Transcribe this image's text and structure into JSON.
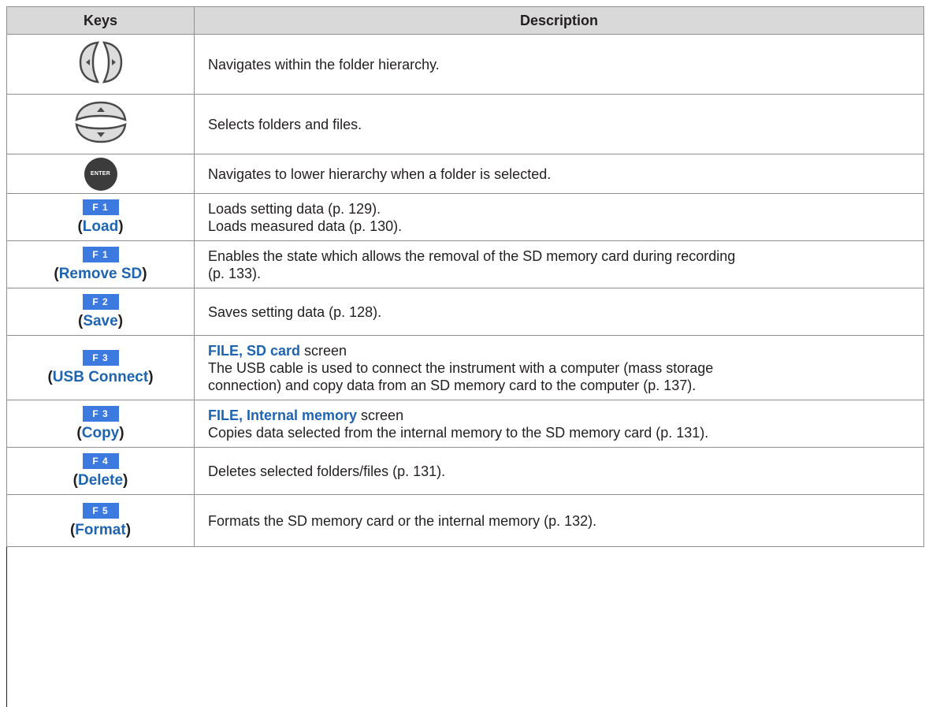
{
  "table": {
    "headers": {
      "keys": "Keys",
      "description": "Description"
    },
    "rows": [
      {
        "key_type": "left-right-arrows",
        "description": [
          "Navigates within the folder hierarchy."
        ]
      },
      {
        "key_type": "up-down-arrows",
        "description": [
          "Selects folders and files."
        ]
      },
      {
        "key_type": "enter",
        "key_label": "ENTER",
        "description": [
          "Navigates to lower hierarchy when a folder is selected."
        ]
      },
      {
        "key_type": "function",
        "fkey": "F1",
        "name_open": "(",
        "name": "Load",
        "name_close": ")",
        "description": [
          "Loads setting data (p. 129).",
          "Loads measured data (p. 130)."
        ]
      },
      {
        "key_type": "function",
        "fkey": "F1",
        "name_open": "(",
        "name": "Remove SD",
        "name_close": ")",
        "description": [
          "Enables the state which allows the removal of the SD memory card during recording",
          "(p. 133)."
        ]
      },
      {
        "key_type": "function",
        "fkey": "F2",
        "name_open": "(",
        "name": "Save",
        "name_close": ")",
        "description": [
          "Saves setting data (p. 128)."
        ]
      },
      {
        "key_type": "function",
        "fkey": "F3",
        "name_open": "(",
        "name": "USB Connect",
        "name_close": ")",
        "screen": "FILE, SD card",
        "screen_suffix": " screen",
        "description": [
          "The USB cable is used to connect the instrument with a computer (mass storage",
          "connection) and copy data from an SD memory card to the computer (p. 137)."
        ]
      },
      {
        "key_type": "function",
        "fkey": "F3",
        "name_open": "(",
        "name": "Copy",
        "name_close": ")",
        "screen": "FILE, Internal memory",
        "screen_suffix": " screen",
        "description": [
          "Copies data selected from the internal memory to the SD memory card (p. 131)."
        ]
      },
      {
        "key_type": "function",
        "fkey": "F4",
        "name_open": "(",
        "name": "Delete",
        "name_close": ")",
        "description": [
          "Deletes selected folders/files (p. 131)."
        ]
      },
      {
        "key_type": "function",
        "fkey": "F5",
        "name_open": "(",
        "name": "Format",
        "name_close": ")",
        "description": [
          "Formats the SD memory card or the internal memory (p. 132)."
        ]
      }
    ]
  },
  "colors": {
    "function_key_bg": "#3d7ae0",
    "function_name": "#1f64b0",
    "header_bg": "#d9d9d9",
    "enter_key_bg": "#3c3c3c",
    "arrow_key_bg": "#dcdcdc",
    "arrow_key_inner": "#4a4a4a"
  }
}
